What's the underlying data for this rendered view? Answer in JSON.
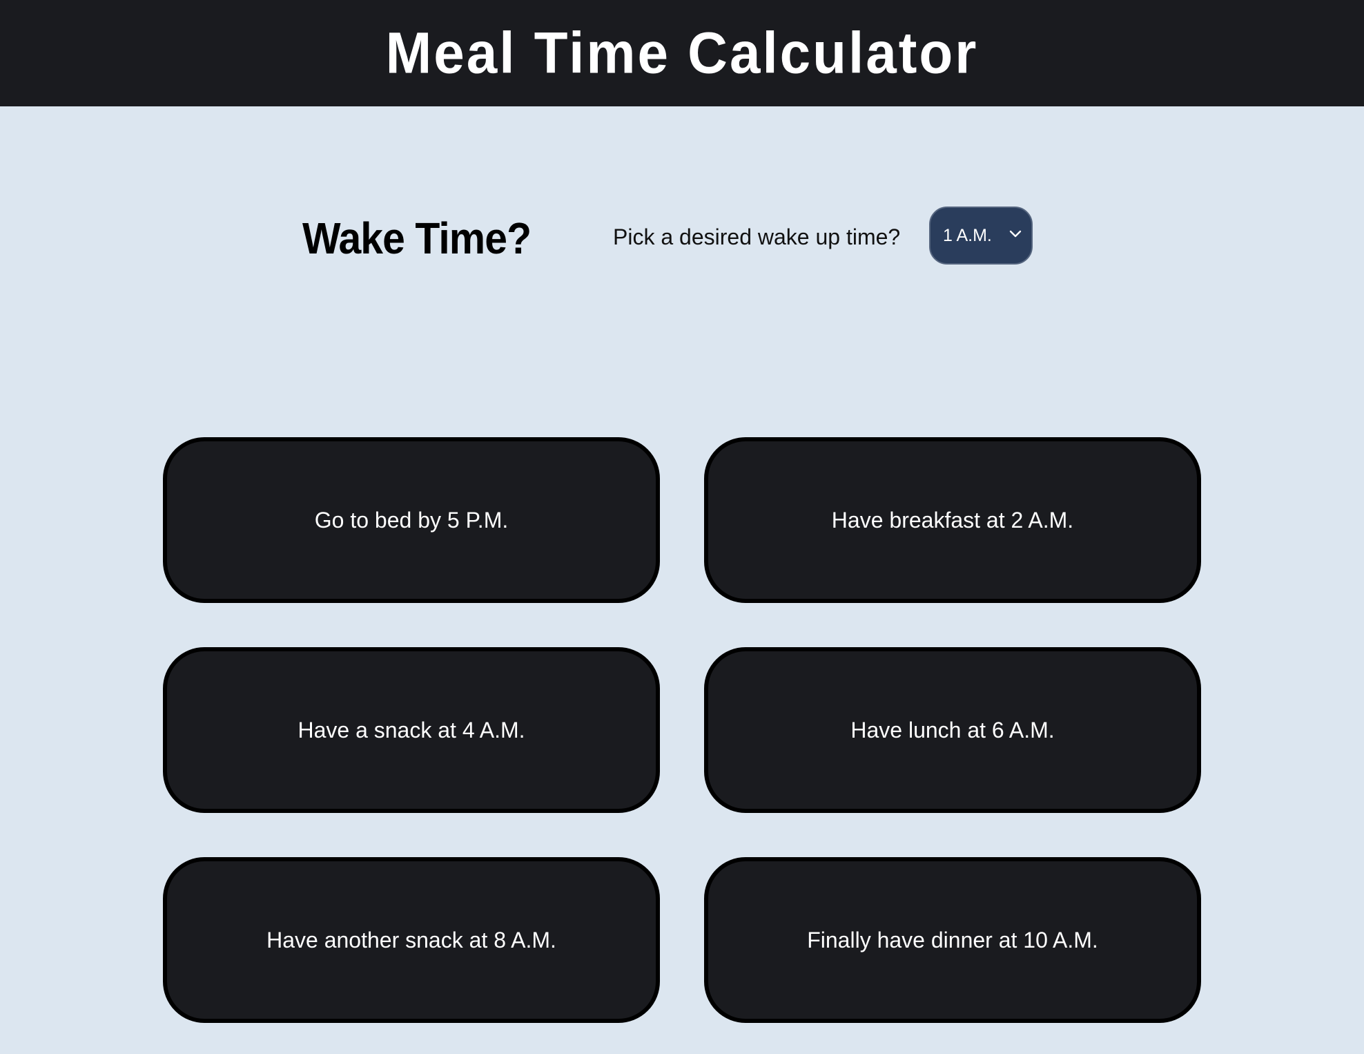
{
  "header": {
    "title": "Meal Time Calculator"
  },
  "wake": {
    "heading": "Wake Time?",
    "prompt": "Pick a desired wake up time?",
    "select": {
      "selected": "1 A.M.",
      "icon": "chevron-down-icon"
    }
  },
  "schedule": {
    "bedtime": "Go to bed by 5 P.M.",
    "breakfast": "Have breakfast at 2 A.M.",
    "snack1": "Have a snack at 4 A.M.",
    "lunch": "Have lunch at 6 A.M.",
    "snack2": "Have another snack at 8 A.M.",
    "dinner": "Finally have dinner at 10 A.M."
  },
  "colors": {
    "header_bg": "#1a1b1f",
    "page_bg": "#dce6f0",
    "card_bg": "#1a1b1f",
    "select_bg": "#2a3d5c"
  }
}
